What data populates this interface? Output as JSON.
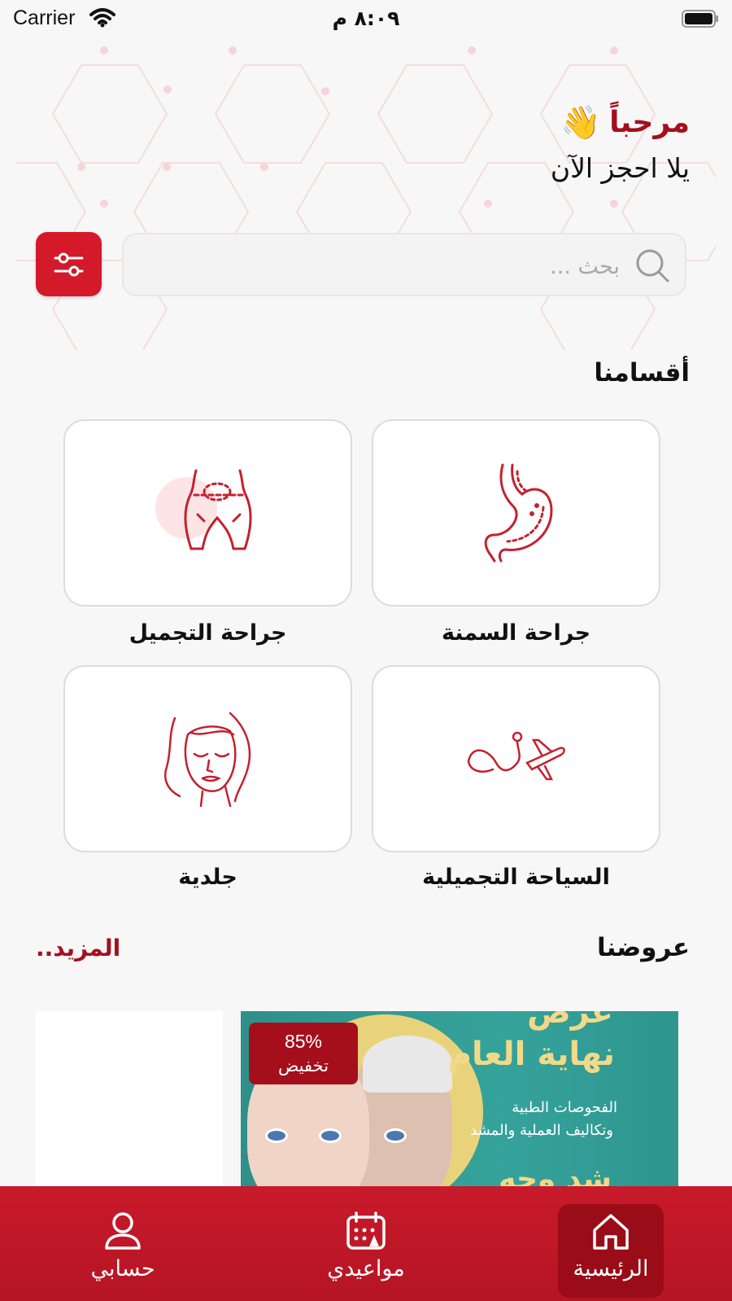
{
  "status_bar": {
    "carrier": "Carrier",
    "time": "٨:٠٩ م"
  },
  "greeting": {
    "title": "مرحباً",
    "wave_emoji": "👋",
    "subtitle": "يلا احجز الآن"
  },
  "search": {
    "placeholder": "بحث ..."
  },
  "departments": {
    "title": "أقسامنا",
    "items": [
      {
        "label": "جراحة السمنة",
        "icon": "stomach-icon"
      },
      {
        "label": "جراحة التجميل",
        "icon": "body-contour-icon"
      },
      {
        "label": "السياحة التجميلية",
        "icon": "stethoscope-plane-icon"
      },
      {
        "label": "جلدية",
        "icon": "face-icon"
      }
    ]
  },
  "offers": {
    "title": "عروضنا",
    "more_label": "المزيد..",
    "banner": {
      "heading_top": "عرض",
      "heading": "نهاية العام",
      "line1": "الفحوصات الطبية",
      "line2": "وتكاليف العملية والمشد",
      "cut_text": "شد وجه",
      "discount_percent": "85%",
      "discount_label": "تخفيض"
    }
  },
  "tab_bar": {
    "items": [
      {
        "label": "الرئيسية",
        "icon": "home-icon",
        "active": true
      },
      {
        "label": "مواعيدي",
        "icon": "calendar-icon",
        "active": false
      },
      {
        "label": "حسابي",
        "icon": "user-icon",
        "active": false
      }
    ]
  },
  "colors": {
    "accent": "#d3192a",
    "accent_dark": "#a50f1c",
    "background": "#f7f7f7"
  }
}
